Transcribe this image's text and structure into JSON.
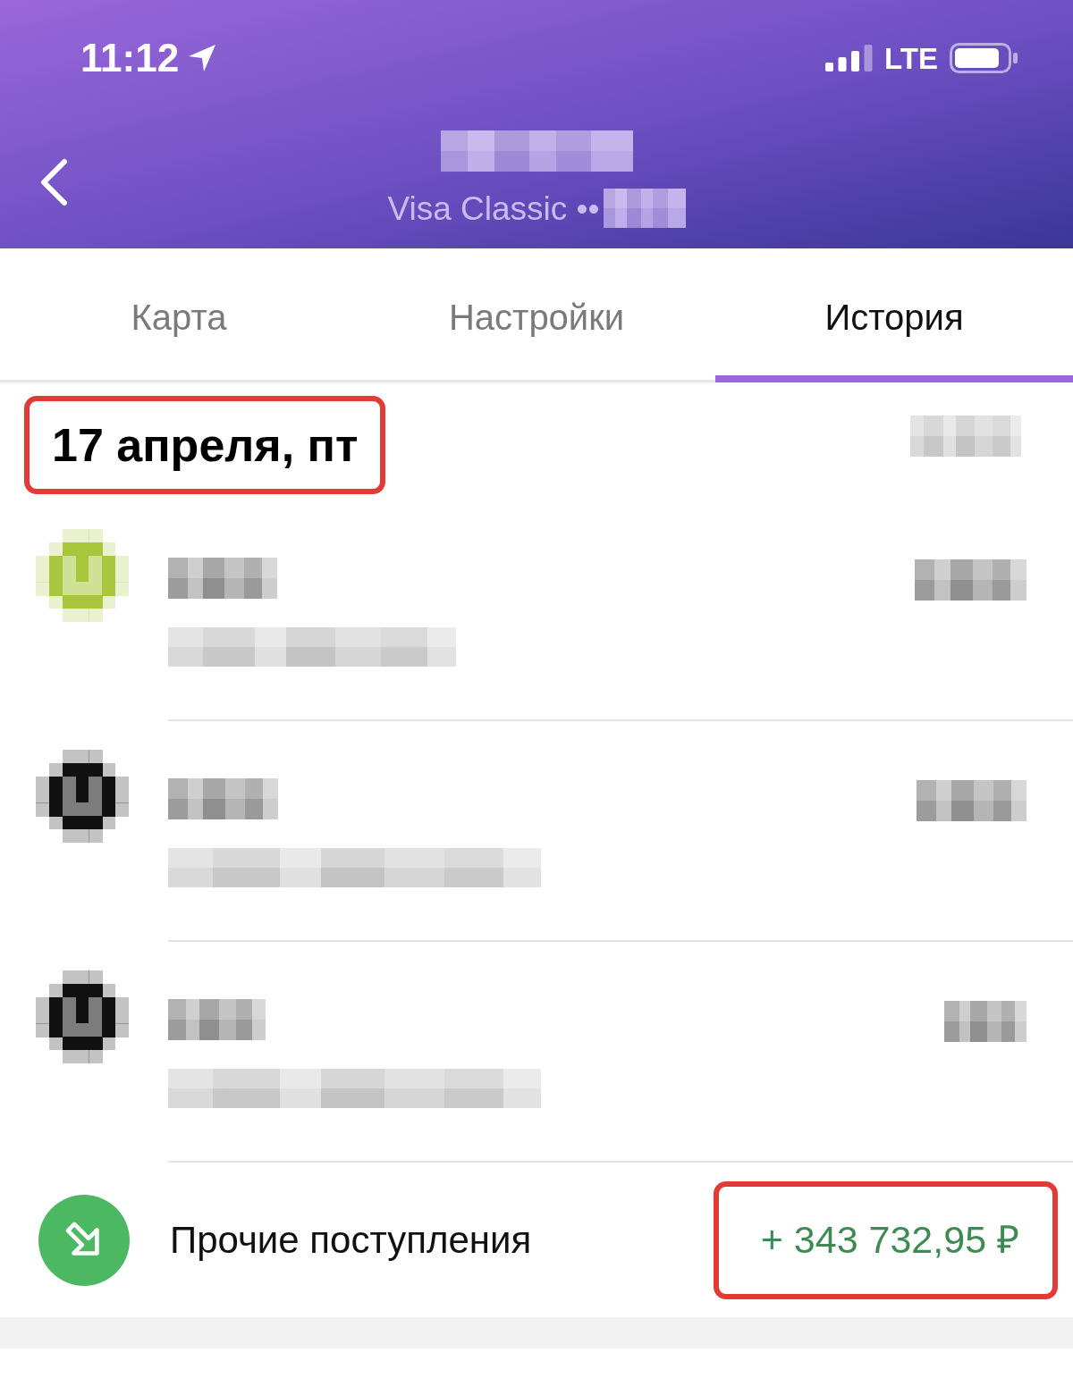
{
  "status_bar": {
    "time": "11:12",
    "network": "LTE"
  },
  "header": {
    "title_redacted": true,
    "subtitle": "Visa Classic ••",
    "subtitle_redacted": true
  },
  "tabs": [
    {
      "label": "Карта",
      "selected": false
    },
    {
      "label": "Настройки",
      "selected": false
    },
    {
      "label": "История",
      "selected": true
    }
  ],
  "history": {
    "date": "17 апреля, пт",
    "date_highlighted": true,
    "total_redacted": true,
    "transactions": [
      {
        "kind": "redacted",
        "color": "#a9c63c"
      },
      {
        "kind": "redacted",
        "color": "#111111"
      },
      {
        "kind": "redacted",
        "color": "#111111"
      },
      {
        "kind": "income",
        "title": "Прочие поступления",
        "amount": "+ 343 732,95 ₽",
        "highlighted": true
      }
    ]
  }
}
